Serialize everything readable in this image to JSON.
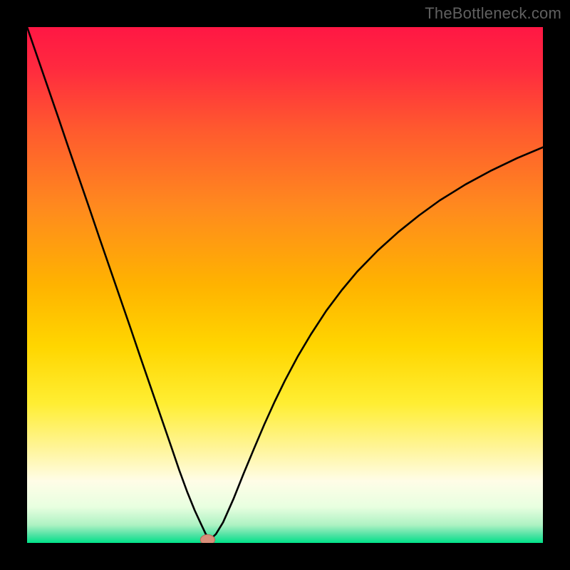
{
  "attribution": "TheBottleneck.com",
  "chart_data": {
    "type": "line",
    "title": "",
    "xlabel": "",
    "ylabel": "",
    "xlim": [
      0,
      100
    ],
    "ylim": [
      0,
      100
    ],
    "grid": false,
    "legend": false,
    "background": {
      "type": "vertical-gradient",
      "stops": [
        {
          "offset": 0.0,
          "color": "#ff1744"
        },
        {
          "offset": 0.08,
          "color": "#ff2a3f"
        },
        {
          "offset": 0.2,
          "color": "#ff5a2e"
        },
        {
          "offset": 0.35,
          "color": "#ff8a1e"
        },
        {
          "offset": 0.5,
          "color": "#ffb300"
        },
        {
          "offset": 0.62,
          "color": "#ffd600"
        },
        {
          "offset": 0.73,
          "color": "#ffee33"
        },
        {
          "offset": 0.82,
          "color": "#fff59d"
        },
        {
          "offset": 0.88,
          "color": "#fffde7"
        },
        {
          "offset": 0.93,
          "color": "#e8ffe0"
        },
        {
          "offset": 0.965,
          "color": "#aef2c3"
        },
        {
          "offset": 0.985,
          "color": "#4de2a3"
        },
        {
          "offset": 1.0,
          "color": "#00e288"
        }
      ]
    },
    "series": [
      {
        "name": "bottleneck-curve",
        "color": "#000000",
        "width": 2.6,
        "x": [
          0.0,
          2.0,
          4.0,
          6.0,
          8.0,
          10.0,
          12.0,
          14.0,
          16.0,
          18.0,
          20.0,
          22.0,
          24.0,
          26.0,
          28.0,
          29.5,
          31.0,
          32.5,
          33.8,
          34.6,
          35.4,
          36.6,
          38.0,
          40.0,
          42.0,
          44.0,
          46.0,
          48.0,
          50.0,
          52.5,
          55.0,
          58.0,
          61.0,
          64.0,
          68.0,
          72.0,
          76.0,
          80.0,
          85.0,
          90.0,
          95.0,
          100.0
        ],
        "y": [
          100.0,
          94.2,
          88.4,
          82.6,
          76.7,
          70.9,
          65.1,
          59.2,
          53.4,
          47.6,
          41.8,
          35.9,
          30.1,
          24.3,
          18.5,
          14.1,
          10.0,
          6.3,
          3.5,
          1.8,
          0.6,
          1.7,
          4.0,
          8.5,
          13.5,
          18.3,
          23.0,
          27.4,
          31.5,
          36.2,
          40.4,
          45.0,
          49.0,
          52.6,
          56.7,
          60.3,
          63.5,
          66.4,
          69.5,
          72.2,
          74.6,
          76.7
        ]
      }
    ],
    "marker": {
      "name": "optimal-point",
      "x": 35.0,
      "y": 0.6,
      "rx": 1.4,
      "ry": 1.0,
      "fill": "#d98f7a",
      "stroke": "#b86a5a"
    }
  }
}
